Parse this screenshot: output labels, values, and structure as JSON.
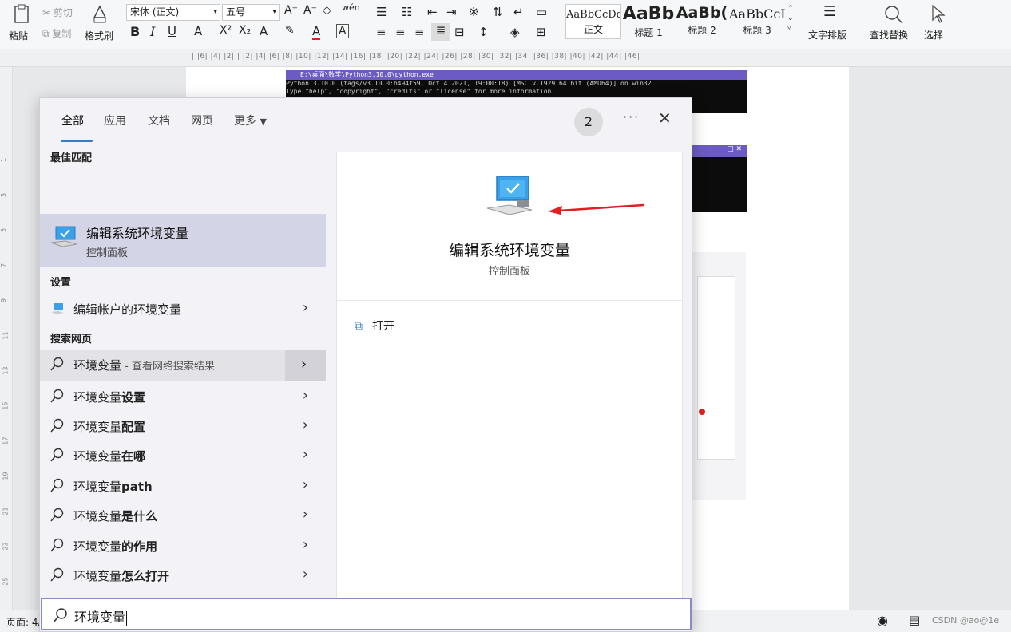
{
  "ribbon": {
    "paste": "粘贴",
    "cut": "剪切",
    "copy": "复制",
    "format_painter": "格式刷",
    "font_name": "宋体 (正文)",
    "font_size": "五号",
    "pinyin": "wén",
    "styles": [
      {
        "sample": "AaBbCcDd",
        "label": "正文"
      },
      {
        "sample": "AaBb",
        "label": "标题 1"
      },
      {
        "sample": "AaBb(",
        "label": "标题 2"
      },
      {
        "sample": "AaBbCcI",
        "label": "标题 3"
      }
    ],
    "text_layout": "文字排版",
    "find_replace": "查找替换",
    "select": "选择"
  },
  "ruler": {
    "ticks": "| |6| |4| |2| |  |2| |4| |6| |8| |10| |12| |14| |16| |18| |20| |22| |24| |26| |28| |30| |32| |34| |36| |38| |40| |42| |44| |46| |"
  },
  "document": {
    "terminal_title": "E:\\桌面\\数学\\Python3.10.0\\python.exe",
    "terminal_line1": "Python 3.10.0 (tags/v3.10.0:b494f59, Oct  4 2021, 19:00:18) [MSC v.1929 64 bit (AMD64)] on win32",
    "terminal_line2": "Type \"help\", \"copyright\", \"credits\" or \"license\" for more information."
  },
  "search_panel": {
    "tabs": [
      "全部",
      "应用",
      "文档",
      "网页",
      "更多"
    ],
    "badge": "2",
    "more_dots": "···",
    "sections": {
      "best_match": "最佳匹配",
      "settings": "设置",
      "web": "搜索网页"
    },
    "best_match": {
      "title": "编辑系统环境变量",
      "subtitle": "控制面板"
    },
    "settings_item": "编辑帐户的环境变量",
    "web_items": [
      {
        "prefix": "环境变量",
        "bold": "",
        "suffix": " - 查看网络搜索结果"
      },
      {
        "prefix": "环境变量",
        "bold": "设置",
        "suffix": ""
      },
      {
        "prefix": "环境变量",
        "bold": "配置",
        "suffix": ""
      },
      {
        "prefix": "环境变量",
        "bold": "在哪",
        "suffix": ""
      },
      {
        "prefix": "环境变量",
        "bold": "path",
        "suffix": ""
      },
      {
        "prefix": "环境变量",
        "bold": "是什么",
        "suffix": ""
      },
      {
        "prefix": "环境变量",
        "bold": "的作用",
        "suffix": ""
      },
      {
        "prefix": "环境变量",
        "bold": "怎么打开",
        "suffix": ""
      }
    ],
    "detail": {
      "title": "编辑系统环境变量",
      "subtitle": "控制面板",
      "action_open": "打开"
    },
    "query": "环境变量"
  },
  "statusbar": {
    "page_label": "页面: 4/",
    "watermark": "CSDN @ao@1e"
  },
  "colors": {
    "accent": "#2f7fd0",
    "best_match_bg": "#d4d4e7",
    "arrow": "#e02020",
    "terminal_title": "#6d5bc4"
  }
}
